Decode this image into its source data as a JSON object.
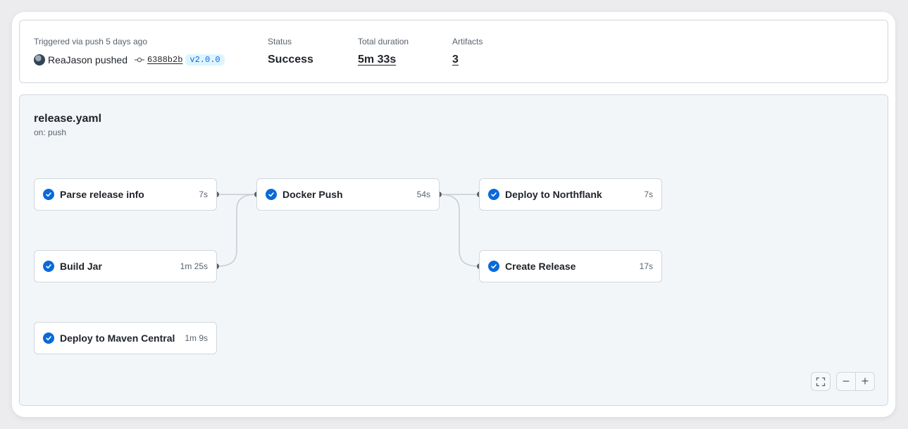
{
  "summary": {
    "trigger_text": "Triggered via push 5 days ago",
    "actor": "ReaJason",
    "action": "pushed",
    "commit_sha": "6388b2b",
    "tag": "v2.0.0",
    "status_label": "Status",
    "status_value": "Success",
    "duration_label": "Total duration",
    "duration_value": "5m 33s",
    "artifacts_label": "Artifacts",
    "artifacts_value": "3"
  },
  "workflow": {
    "file": "release.yaml",
    "trigger": "on: push",
    "jobs": [
      {
        "name": "Parse release info",
        "duration": "7s",
        "status": "success"
      },
      {
        "name": "Build Jar",
        "duration": "1m 25s",
        "status": "success"
      },
      {
        "name": "Deploy to Maven Central",
        "duration": "1m 9s",
        "status": "success"
      },
      {
        "name": "Docker Push",
        "duration": "54s",
        "status": "success"
      },
      {
        "name": "Deploy to Northflank",
        "duration": "7s",
        "status": "success"
      },
      {
        "name": "Create Release",
        "duration": "17s",
        "status": "success"
      }
    ]
  },
  "colors": {
    "success": "#0969da",
    "edge": "#c6ccd2",
    "port": "#57606a"
  },
  "icons": {
    "commit": "git-commit-icon",
    "check": "check-circle-fill-icon",
    "fullscreen": "screen-full-icon",
    "zoom_out": "dash-icon",
    "zoom_in": "plus-icon"
  },
  "zoom": {
    "out_label": "−",
    "in_label": "+"
  }
}
